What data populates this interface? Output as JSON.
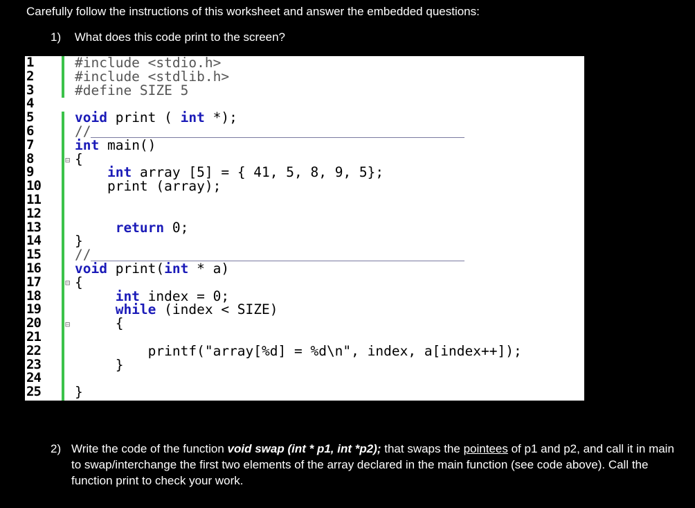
{
  "intro": "Carefully follow the instructions of this worksheet and answer the embedded questions:",
  "q1": {
    "number": "1)",
    "text": "What does this code print to the screen?"
  },
  "code": {
    "line_numbers": [
      "1",
      "2",
      "3",
      "4",
      "5",
      "6",
      "7",
      "8",
      "9",
      "10",
      "11",
      "12",
      "13",
      "14",
      "15",
      "16",
      "17",
      "18",
      "19",
      "20",
      "21",
      "22",
      "23",
      "24",
      "25"
    ],
    "lines": [
      "#include <stdio.h>",
      "#include <stdlib.h>",
      "#define SIZE 5",
      "",
      "void print ( int *);",
      "//",
      "int main()",
      "{",
      "    int array [5] = { 41, 5, 8, 9, 5};",
      "    print (array);",
      "",
      "",
      "     return 0;",
      "}",
      "//",
      "void print(int * a)",
      "{",
      "     int index = 0;",
      "     while (index < SIZE)",
      "     {",
      "",
      "         printf(\"array[%d] = %d\\n\", index, a[index++]);",
      "     }",
      "",
      "}"
    ]
  },
  "q2": {
    "number": "2)",
    "text_before": "Write the code of the function ",
    "signature": "void swap (int * p1, int *p2);",
    "text_after_1": " that swaps the ",
    "pointees": "pointees",
    "text_after_2": " of p1 and p2, and call it in main to swap/interchange the first two elements of the array declared in the main function (see code above). Call the function print to check your work."
  }
}
